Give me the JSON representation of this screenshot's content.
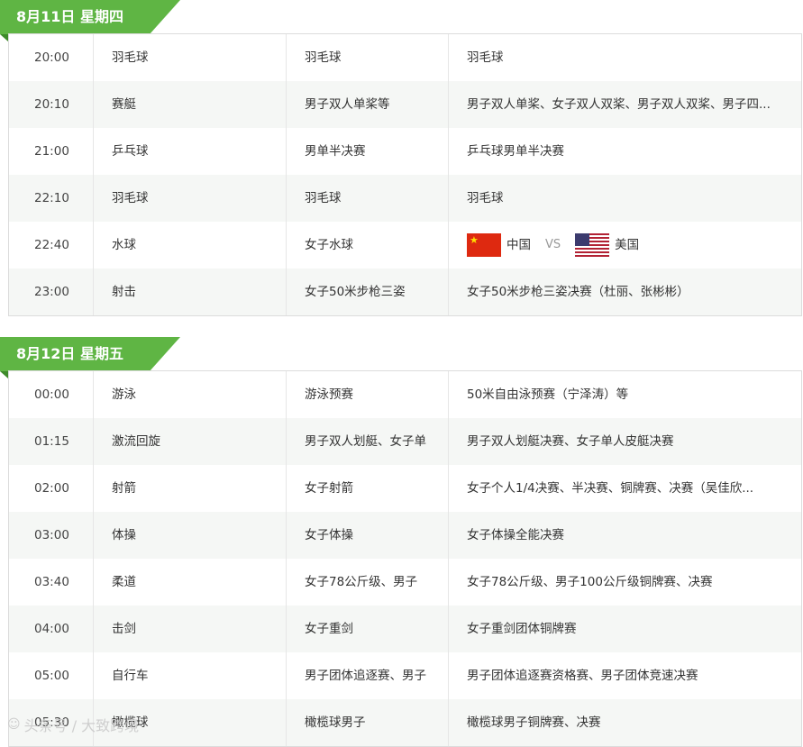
{
  "days": [
    {
      "title": "8月11日 星期四",
      "rows": [
        {
          "time": "20:00",
          "sport": "羽毛球",
          "event": "羽毛球",
          "detail": "羽毛球"
        },
        {
          "time": "20:10",
          "sport": "赛艇",
          "event": "男子双人单桨等",
          "detail": "男子双人单桨、女子双人双桨、男子双人双桨、男子四..."
        },
        {
          "time": "21:00",
          "sport": "乒乓球",
          "event": "男单半决赛",
          "detail": "乒乓球男单半决赛"
        },
        {
          "time": "22:10",
          "sport": "羽毛球",
          "event": "羽毛球",
          "detail": "羽毛球"
        },
        {
          "time": "22:40",
          "sport": "水球",
          "event": "女子水球",
          "match": {
            "team1": "中国",
            "vs": "VS",
            "team2": "美国"
          }
        },
        {
          "time": "23:00",
          "sport": "射击",
          "event": "女子50米步枪三姿",
          "detail": "女子50米步枪三姿决赛（杜丽、张彬彬）"
        }
      ]
    },
    {
      "title": "8月12日 星期五",
      "rows": [
        {
          "time": "00:00",
          "sport": "游泳",
          "event": "游泳预赛",
          "detail": "50米自由泳预赛（宁泽涛）等"
        },
        {
          "time": "01:15",
          "sport": "激流回旋",
          "event": "男子双人划艇、女子单",
          "detail": "男子双人划艇决赛、女子单人皮艇决赛"
        },
        {
          "time": "02:00",
          "sport": "射箭",
          "event": "女子射箭",
          "detail": "女子个人1/4决赛、半决赛、铜牌赛、决赛（吴佳欣..."
        },
        {
          "time": "03:00",
          "sport": "体操",
          "event": "女子体操",
          "detail": "女子体操全能决赛"
        },
        {
          "time": "03:40",
          "sport": "柔道",
          "event": "女子78公斤级、男子",
          "detail": "女子78公斤级、男子100公斤级铜牌赛、决赛"
        },
        {
          "time": "04:00",
          "sport": "击剑",
          "event": "女子重剑",
          "detail": "女子重剑团体铜牌赛"
        },
        {
          "time": "05:00",
          "sport": "自行车",
          "event": "男子团体追逐赛、男子",
          "detail": "男子团体追逐赛资格赛、男子团体竞速决赛"
        },
        {
          "time": "05:30",
          "sport": "橄榄球",
          "event": "橄榄球男子",
          "detail": "橄榄球男子铜牌赛、决赛"
        }
      ]
    }
  ],
  "watermark": "头条号 / 大致跨境"
}
